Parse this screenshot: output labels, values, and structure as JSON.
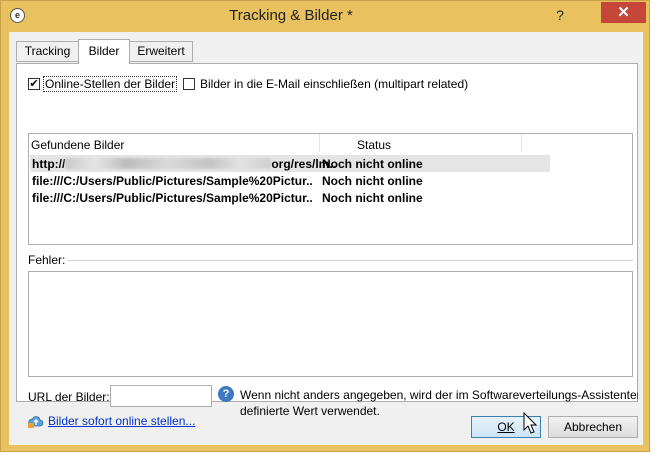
{
  "window": {
    "title": "Tracking & Bilder *",
    "help": "?",
    "close": "✕"
  },
  "tabs": [
    {
      "label": "Tracking"
    },
    {
      "label": "Bilder"
    },
    {
      "label": "Erweitert"
    }
  ],
  "options": {
    "online_label": "Online-Stellen der Bilder",
    "online_checked": true,
    "include_label": "Bilder in die E-Mail einschließen (multipart related)",
    "include_checked": false
  },
  "images_list": {
    "columns": [
      "Gefundene Bilder",
      "Status"
    ],
    "rows": [
      {
        "url_prefix": "http://",
        "url_suffix": "org/res/lm..",
        "status": "Noch nicht online"
      },
      {
        "url": "file:///C:/Users/Public/Pictures/Sample%20Pictur..",
        "status": "Noch nicht online"
      },
      {
        "url": "file:///C:/Users/Public/Pictures/Sample%20Pictur..",
        "status": "Noch nicht online"
      }
    ]
  },
  "errors": {
    "label": "Fehler:"
  },
  "url_field": {
    "label": "URL der Bilder:",
    "value": "",
    "info_line1": "Wenn nicht anders angegeben, wird der im Softwareverteilungs-Assistenten",
    "info_line2": "definierte Wert verwendet."
  },
  "publish_link": "Bilder sofort online stellen...",
  "buttons": {
    "ok": "OK",
    "cancel": "Abbrechen"
  },
  "colors": {
    "frame": "#e9c15e",
    "close": "#c7463a",
    "link": "#0033cc",
    "info": "#3f78c1"
  }
}
